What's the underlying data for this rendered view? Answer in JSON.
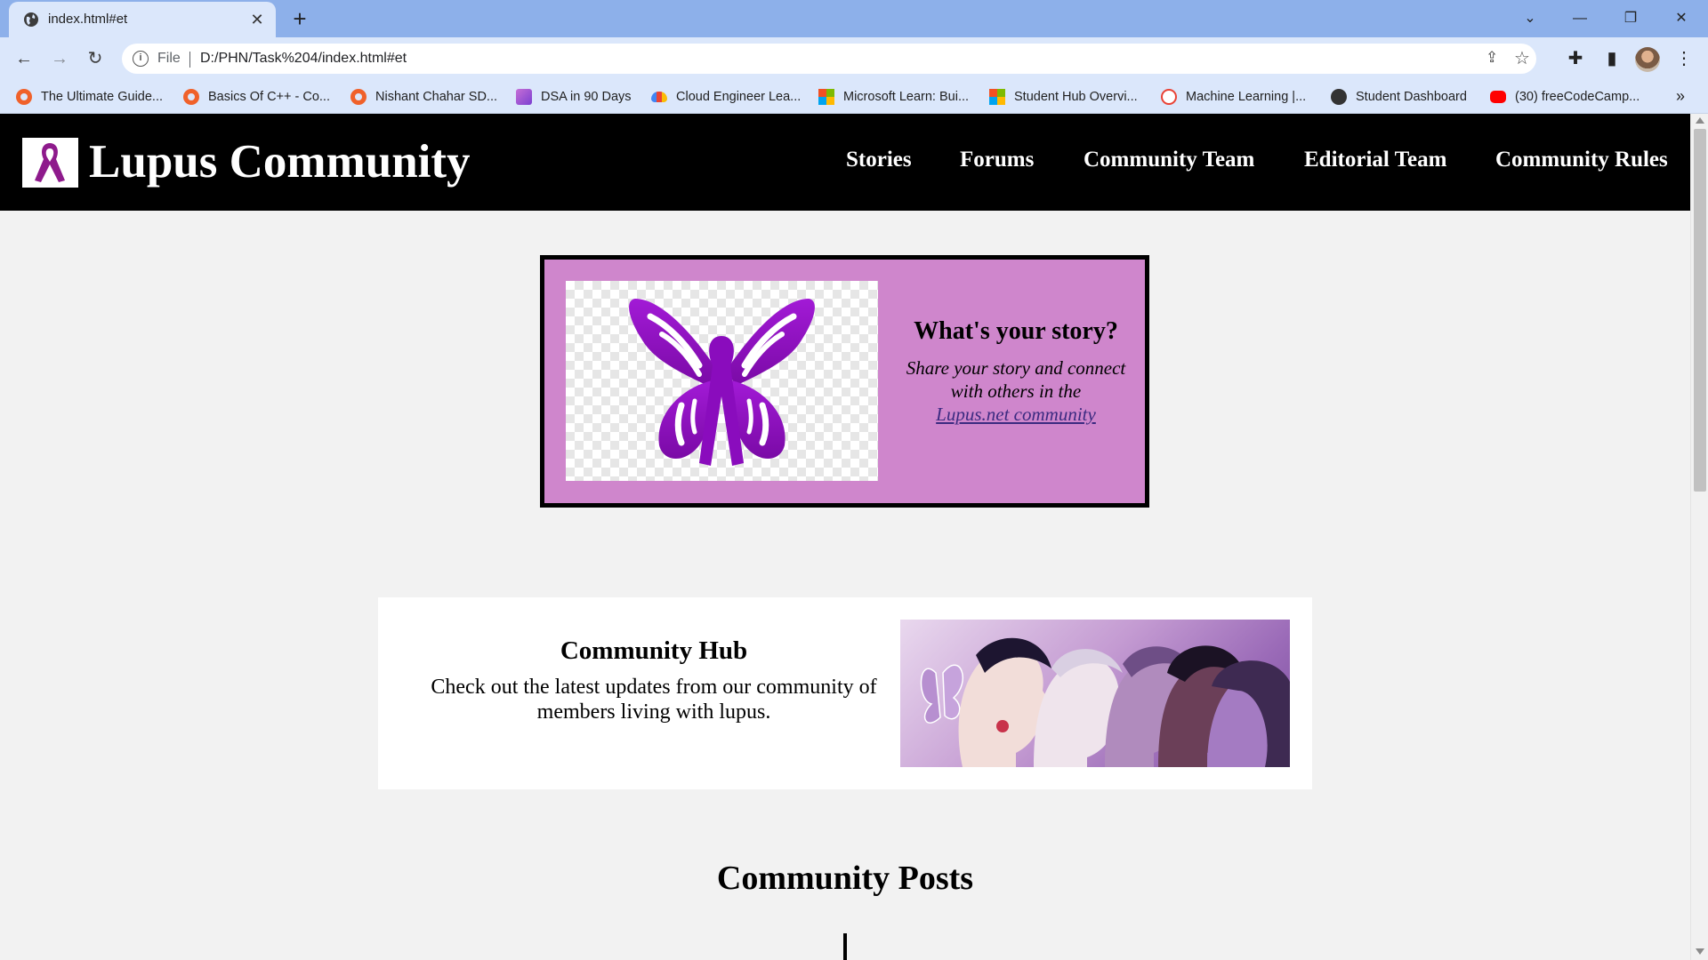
{
  "browser": {
    "tab_title": "index.html#et",
    "new_tab_label": "+",
    "scheme_label": "File",
    "url": "D:/PHN/Task%204/index.html#et",
    "bookmarks": [
      {
        "label": "The Ultimate Guide...",
        "icon": "coding-ninjas-icon"
      },
      {
        "label": "Basics Of C++ - Co...",
        "icon": "coding-ninjas-icon"
      },
      {
        "label": "Nishant Chahar SD...",
        "icon": "coding-ninjas-icon"
      },
      {
        "label": "DSA in 90 Days",
        "icon": "dsa-icon"
      },
      {
        "label": "Cloud Engineer Lea...",
        "icon": "google-cloud-icon"
      },
      {
        "label": "Microsoft Learn: Bui...",
        "icon": "microsoft-icon"
      },
      {
        "label": "Student Hub Overvi...",
        "icon": "microsoft-icon"
      },
      {
        "label": "Machine Learning |...",
        "icon": "google-ml-icon"
      },
      {
        "label": "Student Dashboard",
        "icon": "globe-icon"
      },
      {
        "label": "(30) freeCodeCamp...",
        "icon": "youtube-icon"
      }
    ],
    "bookmarks_more": "»"
  },
  "site": {
    "title": "Lupus Community",
    "nav": [
      "Stories",
      "Forums",
      "Community Team",
      "Editorial Team",
      "Community Rules"
    ]
  },
  "story_card": {
    "heading": "What's your story?",
    "body": "Share your story and connect with others in the",
    "link": "Lupus.net community",
    "image_icon": "purple-butterfly-ribbon"
  },
  "hub_card": {
    "heading": "Community Hub",
    "body": "Check out the latest updates from our community of members living with lupus.",
    "image_icon": "illustrated-faces-with-butterfly"
  },
  "posts": {
    "heading": "Community Posts"
  },
  "colors": {
    "header_bg": "#000000",
    "story_card_bg": "#cf86cc",
    "butterfly": "#9410c4",
    "page_bg": "#f2f2f2",
    "tabbar_bg": "#8db0ea",
    "toolbar_bg": "#dbe7fb"
  }
}
